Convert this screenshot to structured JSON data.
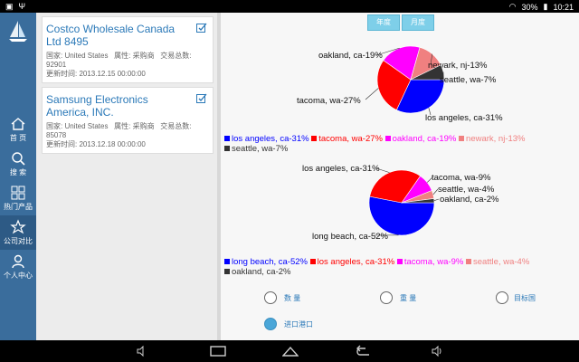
{
  "status_bar": {
    "battery": "30%",
    "time": "10:21"
  },
  "sidebar": {
    "logo": "sailboat-logo",
    "items": [
      {
        "label": "首 页",
        "icon": "home-icon"
      },
      {
        "label": "搜 索",
        "icon": "search-icon"
      },
      {
        "label": "热门产品",
        "icon": "grid-icon"
      },
      {
        "label": "公司对比",
        "icon": "compare-icon",
        "active": true
      },
      {
        "label": "个人中心",
        "icon": "person-icon"
      }
    ]
  },
  "companies": [
    {
      "name": "Costco Wholesale Canada Ltd 8495",
      "country": "国家: United States",
      "attr": "属性: 采购商",
      "total_label": "交易总数:",
      "total": "92901",
      "updated": "更新时间: 2013.12.15 00:00:00"
    },
    {
      "name": "Samsung Electronics America, INC.",
      "country": "国家: United States",
      "attr": "属性: 采购商",
      "total_label": "交易总数:",
      "total": "85078",
      "updated": "更新时间: 2013.12.18 00:00:00"
    }
  ],
  "period_tabs": {
    "year": "年度",
    "month": "月度"
  },
  "colors": {
    "accent": "#3a6d9c",
    "link": "#2b79b8",
    "tab": "#7ecfe9"
  },
  "chart_data": [
    {
      "type": "pie",
      "slices": [
        {
          "label": "los angeles, ca-31%",
          "value": 31,
          "color": "#0000ff"
        },
        {
          "label": "tacoma, wa-27%",
          "value": 27,
          "color": "#ff0000"
        },
        {
          "label": "oakland, ca-19%",
          "value": 19,
          "color": "#ff00ff"
        },
        {
          "label": "newark, nj-13%",
          "value": 13,
          "color": "#f08080"
        },
        {
          "label": "seattle, wa-7%",
          "value": 7,
          "color": "#333333"
        }
      ]
    },
    {
      "type": "pie",
      "slices": [
        {
          "label": "long beach, ca-52%",
          "value": 52,
          "color": "#0000ff"
        },
        {
          "label": "los angeles, ca-31%",
          "value": 31,
          "color": "#ff0000"
        },
        {
          "label": "tacoma, wa-9%",
          "value": 9,
          "color": "#ff00ff"
        },
        {
          "label": "seattle, wa-4%",
          "value": 4,
          "color": "#f08080"
        },
        {
          "label": "oakland, ca-2%",
          "value": 2,
          "color": "#333333"
        }
      ]
    }
  ],
  "options": [
    {
      "label": "数 量",
      "selected": false
    },
    {
      "label": "重 量",
      "selected": false
    },
    {
      "label": "目标国",
      "selected": false
    },
    {
      "label": "进口港口",
      "selected": true
    }
  ]
}
